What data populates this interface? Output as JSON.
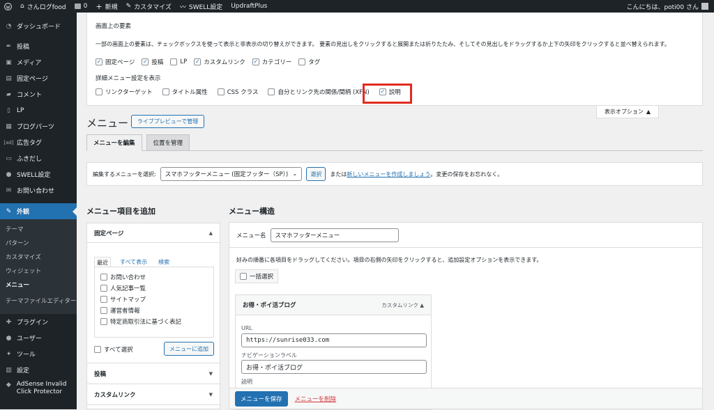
{
  "adminbar": {
    "site_name": "さんログfood",
    "comments_count": "0",
    "new_label": "新規",
    "customize_label": "カスタマイズ",
    "swell_label": "SWELL設定",
    "updraft_label": "UpdraftPlus",
    "greeting": "こんにちは、poti00 さん"
  },
  "sidebar": {
    "items": [
      {
        "icon": "dashboard-icon",
        "label": "ダッシュボード"
      },
      {
        "icon": "pin-icon",
        "label": "投稿"
      },
      {
        "icon": "media-icon",
        "label": "メディア"
      },
      {
        "icon": "page-icon",
        "label": "固定ページ"
      },
      {
        "icon": "comment-icon",
        "label": "コメント"
      },
      {
        "icon": "lp-icon",
        "label": "LP"
      },
      {
        "icon": "blog-parts-icon",
        "label": "ブログパーツ"
      },
      {
        "icon": "ad-tag-icon",
        "label": "広告タグ"
      },
      {
        "icon": "balloon-icon",
        "label": "ふきだし"
      },
      {
        "icon": "swell-icon",
        "label": "SWELL設定"
      },
      {
        "icon": "mail-icon",
        "label": "お問い合わせ"
      }
    ],
    "appearance": {
      "label": "外観"
    },
    "appearance_sub": [
      "テーマ",
      "パターン",
      "カスタマイズ",
      "ウィジェット",
      "メニュー",
      "テーマファイルエディター"
    ],
    "bottom_items": [
      {
        "label": "プラグイン"
      },
      {
        "label": "ユーザー"
      },
      {
        "label": "ツール"
      },
      {
        "label": "設定"
      },
      {
        "label": "AdSense Invalid Click Protector"
      }
    ]
  },
  "screen_options": {
    "title": "画面上の要素",
    "description": "一部の画面上の要素は、チェックボックスを使って表示と非表示の切り替えができます。 要素の見出しをクリックすると展開または折りたたみ、そしてその見出しをドラッグするか上下の矢印をクリックすると並べ替えられます。",
    "boxes": [
      {
        "label": "固定ページ",
        "checked": true
      },
      {
        "label": "投稿",
        "checked": true
      },
      {
        "label": "LP",
        "checked": false
      },
      {
        "label": "カスタムリンク",
        "checked": true
      },
      {
        "label": "カテゴリー",
        "checked": true
      },
      {
        "label": "タグ",
        "checked": false
      }
    ],
    "advanced_title": "詳細メニュー設定を表示",
    "advanced": [
      {
        "label": "リンクターゲット",
        "checked": false
      },
      {
        "label": "タイトル属性",
        "checked": false
      },
      {
        "label": "CSS クラス",
        "checked": false
      },
      {
        "label": "自分とリンク先の関係/間柄 (XFN)",
        "checked": false
      },
      {
        "label": "説明",
        "checked": true
      }
    ],
    "toggle_label": "表示オプション"
  },
  "page": {
    "title": "メニュー",
    "live_preview_button": "ライブプレビューで管理",
    "tabs": [
      "メニューを編集",
      "位置を管理"
    ]
  },
  "select_bar": {
    "label": "編集するメニューを選択:",
    "selected": "スマホフッターメニュー (固定フッター（SP）)",
    "select_button": "選択",
    "or_text": "または",
    "create_link": "新しいメニューを作成しましょう",
    "suffix": "。変更の保存をお忘れなく。"
  },
  "add_items": {
    "heading": "メニュー項目を追加",
    "pages_title": "固定ページ",
    "tabs": [
      "最近",
      "すべて表示",
      "検索"
    ],
    "pages": [
      "お問い合わせ",
      "人気記事一覧",
      "サイトマップ",
      "運営者情報",
      "特定商取引法に基づく表記"
    ],
    "select_all": "すべて選択",
    "add_button": "メニューに追加",
    "posts_title": "投稿",
    "custom_title": "カスタムリンク"
  },
  "structure": {
    "heading": "メニュー構造",
    "name_label": "メニュー名",
    "name_value": "スマホフッターメニュー",
    "instructions": "好みの順番に各項目をドラッグしてください。項目の右側の矢印をクリックすると、追加設定オプションを表示できます。",
    "bulk_select": "一括選択",
    "item": {
      "title": "お得・ポイ活ブログ",
      "type": "カスタムリンク",
      "url_label": "URL",
      "url_value": "https://sunrise033.com",
      "nav_label": "ナビゲーションラベル",
      "nav_value": "お得・ポイ活ブログ",
      "desc_label": "説明"
    },
    "save_button": "メニューを保存",
    "delete_link": "メニューを削除"
  }
}
